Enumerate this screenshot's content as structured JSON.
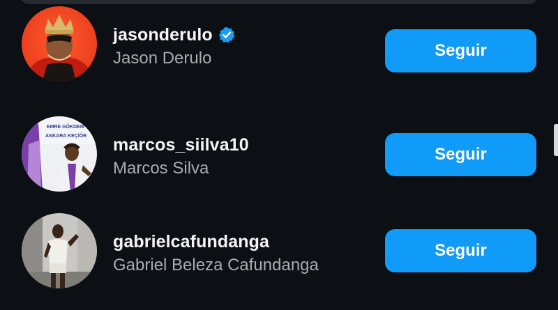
{
  "colors": {
    "background": "#0c0f14",
    "button": "#0f9bf7",
    "verified_badge": "#1d9bf0",
    "secondary_text": "#a8acb3"
  },
  "suggestions": [
    {
      "username": "jasonderulo",
      "fullname": "Jason Derulo",
      "verified": true,
      "button_label": "Seguir"
    },
    {
      "username": "marcos_siilva10",
      "fullname": "Marcos Silva",
      "verified": false,
      "avatar_text": [
        "EMRE GÖKDEM",
        "ANKARA KEÇİÖR"
      ],
      "button_label": "Seguir"
    },
    {
      "username": "gabrielcafundanga",
      "fullname": "Gabriel Beleza Cafundanga",
      "verified": false,
      "button_label": "Seguir"
    }
  ]
}
